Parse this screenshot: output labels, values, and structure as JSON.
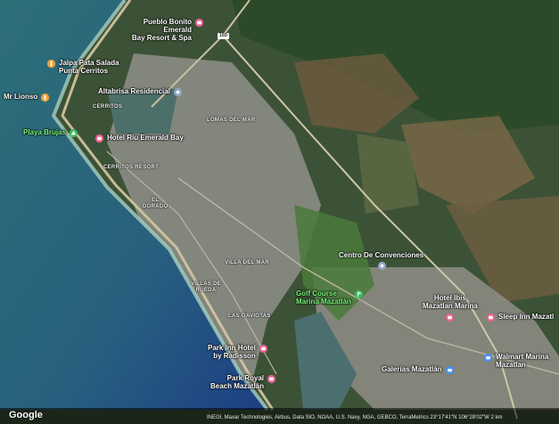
{
  "pois": [
    {
      "id": "pueblo-bonito",
      "label": "Pueblo Bonito Emerald\nBay Resort & Spa",
      "kind": "hotel",
      "color": "#E7608F"
    },
    {
      "id": "jalapa-pata-salada",
      "label": "Jalpa Pata Salada\nPunta Cerritos",
      "kind": "restaurant",
      "color": "#F2A23A"
    },
    {
      "id": "altabrisa",
      "label": "Altabrisa Residencial",
      "kind": "place",
      "color": "#8FA6C8"
    },
    {
      "id": "mr-lionso",
      "label": "Mr Lionso",
      "kind": "restaurant",
      "color": "#F2A23A"
    },
    {
      "id": "playa-brujas",
      "label": "Playa Brujas",
      "kind": "park",
      "color": "#3DBA63"
    },
    {
      "id": "hotel-riu",
      "label": "Hotel Riu Emerald Bay",
      "kind": "hotel",
      "color": "#E7608F"
    },
    {
      "id": "centro-convenciones",
      "label": "Centro De Convenciones",
      "kind": "place",
      "color": "#8FA6C8"
    },
    {
      "id": "golf-course",
      "label": "Golf Course\nMarina Mazatlán",
      "kind": "golf",
      "color": "#3DBA63"
    },
    {
      "id": "hotel-ibis",
      "label": "Hotel Ibis\nMazatlan Marina",
      "kind": "hotel",
      "color": "#E7608F"
    },
    {
      "id": "sleep-inn",
      "label": "Sleep Inn Mazatl",
      "kind": "hotel",
      "color": "#E7608F"
    },
    {
      "id": "park-inn",
      "label": "Park Inn Hotel\nby Radisson",
      "kind": "hotel",
      "color": "#E7608F"
    },
    {
      "id": "walmart",
      "label": "Walmart Marina\nMazatlan",
      "kind": "shopping",
      "color": "#4B8EF0"
    },
    {
      "id": "galerias",
      "label": "Galerías Mazatlán",
      "kind": "shopping",
      "color": "#4B8EF0"
    },
    {
      "id": "park-royal",
      "label": "Park Royal\nBeach Mazatlán",
      "kind": "hotel",
      "color": "#E7608F"
    }
  ],
  "areas": [
    {
      "id": "cerritos",
      "label": "CERRITOS"
    },
    {
      "id": "lomas",
      "label": "LOMAS DEL MAR"
    },
    {
      "id": "cerritos-resort",
      "label": "CERRITOS RESORT"
    },
    {
      "id": "el-dorado",
      "label": "EL\nDORADO"
    },
    {
      "id": "villa-del-mar",
      "label": "VILLA DEL MAR"
    },
    {
      "id": "villas-de-rueda",
      "label": "VILLAS DE\nRUEDA"
    },
    {
      "id": "las-gaviotas",
      "label": "LAS GAVIOTAS"
    }
  ],
  "road_shield": "15D",
  "footer": {
    "logo": "Google",
    "attribution": "INEGI, Maxar Technologies, Airbus, Data SIO, NOAA, U.S. Navy, NGA, GEBCO, TerraMetrics    23°17'41\"N 106°28'02\"W  2 km"
  },
  "colors": {
    "ocean_deep": "#1f4f86",
    "ocean": "#2f6f7a",
    "surf": "#9fc9bf",
    "beach": "#d8c9a8",
    "urban": "#8b8f86",
    "forest": "#2f4d2e",
    "field": "#6c6a4a",
    "lagoon": "#4d6f6a"
  }
}
